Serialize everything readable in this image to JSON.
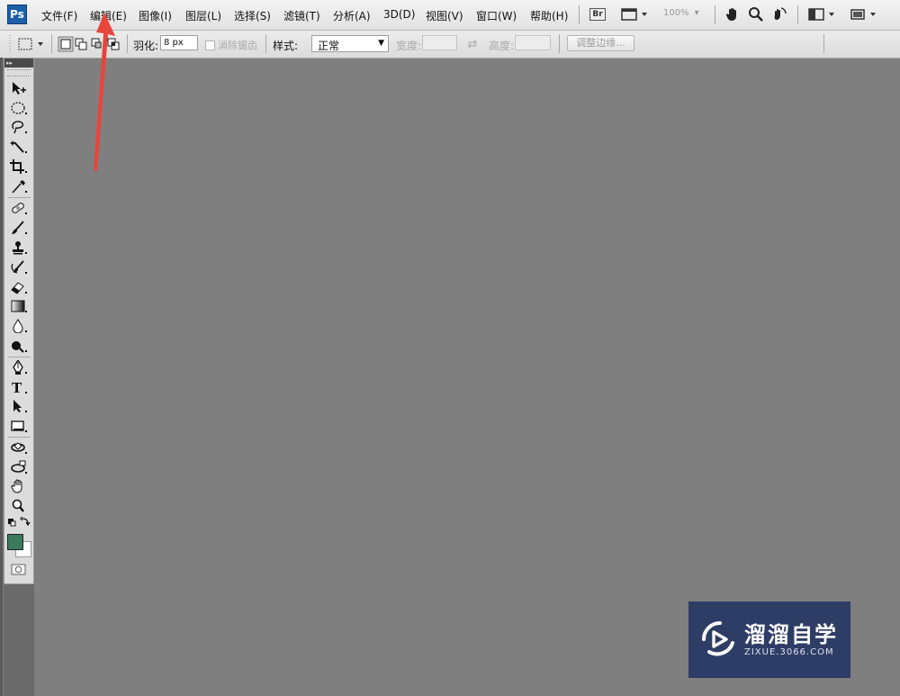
{
  "app": {
    "logo": "Ps"
  },
  "menu": [
    "文件(F)",
    "编辑(E)",
    "图像(I)",
    "图层(L)",
    "选择(S)",
    "滤镜(T)",
    "分析(A)",
    "3D(D)",
    "视图(V)",
    "窗口(W)",
    "帮助(H)"
  ],
  "toolbar": {
    "bridge_label": "Br",
    "zoom_value": "100%",
    "icons": [
      "bridge-icon",
      "screen-mode-icon",
      "hand-icon",
      "zoom-icon",
      "rotate-view-icon",
      "arrange-documents-icon",
      "screen-mode-toggle-icon"
    ]
  },
  "options": {
    "feather_label": "羽化:",
    "feather_value": "8 px",
    "antialias_label": "消除锯齿",
    "style_label": "样式:",
    "style_value": "正常",
    "width_label": "宽度:",
    "height_label": "高度:",
    "refine_edge_label": "调整边缘..."
  },
  "toolbox": {
    "header": "▸▸",
    "tools": [
      "move-tool",
      "elliptical-marquee-tool",
      "lasso-tool",
      "magic-wand-tool",
      "crop-tool",
      "eyedropper-tool",
      "spot-healing-tool",
      "brush-tool",
      "clone-stamp-tool",
      "history-brush-tool",
      "eraser-tool",
      "gradient-tool",
      "blur-tool",
      "dodge-tool",
      "pen-tool",
      "type-tool",
      "path-selection-tool",
      "rectangle-tool",
      "3d-rotate-tool",
      "3d-orbit-tool",
      "hand-tool",
      "zoom-tool"
    ],
    "foreground_color": "#3a7a5e",
    "background_color": "#ffffff"
  },
  "canvas": {
    "background": "#7f7f7f"
  },
  "watermark": {
    "title": "溜溜自学",
    "subtitle": "ZIXUE.3066.COM"
  }
}
